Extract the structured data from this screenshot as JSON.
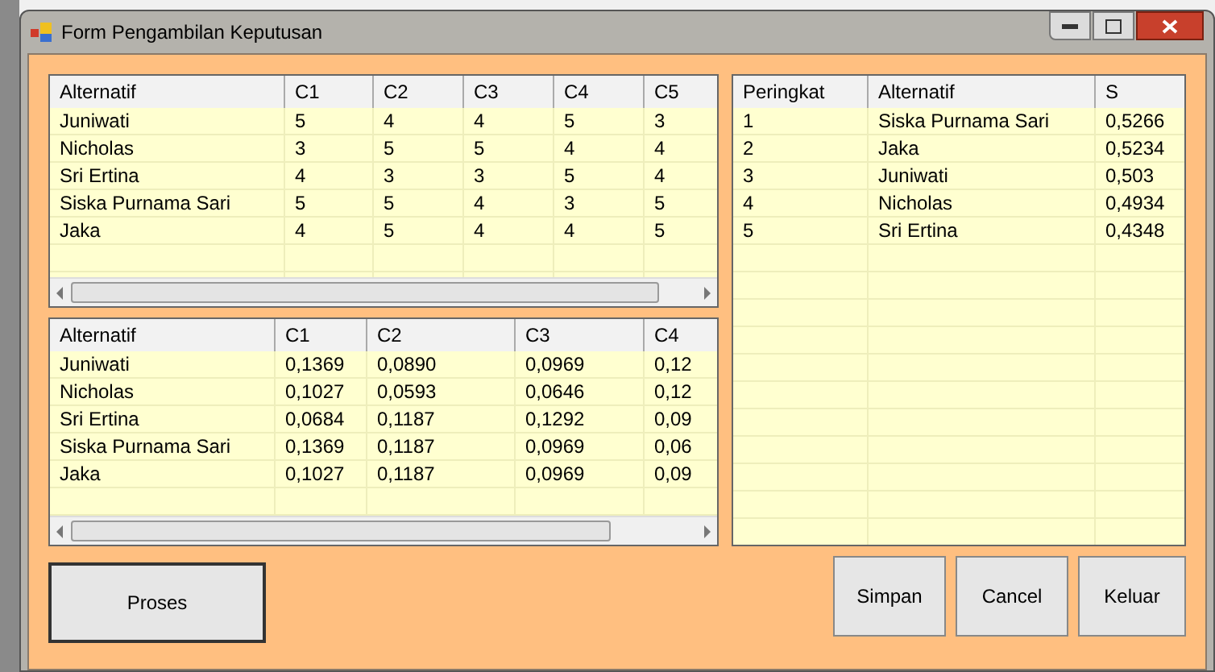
{
  "window": {
    "title": "Form Pengambilan Keputusan"
  },
  "criteria_table": {
    "columns": [
      "Alternatif",
      "C1",
      "C2",
      "C3",
      "C4",
      "C5"
    ],
    "rows": [
      [
        "Juniwati",
        "5",
        "4",
        "4",
        "5",
        "3"
      ],
      [
        "Nicholas",
        "3",
        "5",
        "5",
        "4",
        "4"
      ],
      [
        "Sri Ertina",
        "4",
        "3",
        "3",
        "5",
        "4"
      ],
      [
        "Siska Purnama Sari",
        "5",
        "5",
        "4",
        "3",
        "5"
      ],
      [
        "Jaka",
        "4",
        "5",
        "4",
        "4",
        "5"
      ]
    ]
  },
  "weighted_table": {
    "columns": [
      "Alternatif",
      "C1",
      "C2",
      "C3",
      "C4"
    ],
    "rows": [
      [
        "Juniwati",
        "0,1369",
        "0,0890",
        "0,0969",
        "0,12"
      ],
      [
        "Nicholas",
        "0,1027",
        "0,0593",
        "0,0646",
        "0,12"
      ],
      [
        "Sri Ertina",
        "0,0684",
        "0,1187",
        "0,1292",
        "0,09"
      ],
      [
        "Siska Purnama Sari",
        "0,1369",
        "0,1187",
        "0,0969",
        "0,06"
      ],
      [
        "Jaka",
        "0,1027",
        "0,1187",
        "0,0969",
        "0,09"
      ]
    ]
  },
  "ranking_table": {
    "columns": [
      "Peringkat",
      "Alternatif",
      "S"
    ],
    "rows": [
      [
        "1",
        "Siska Purnama Sari",
        "0,5266"
      ],
      [
        "2",
        "Jaka",
        "0,5234"
      ],
      [
        "3",
        "Juniwati",
        "0,503"
      ],
      [
        "4",
        "Nicholas",
        "0,4934"
      ],
      [
        "5",
        "Sri Ertina",
        "0,4348"
      ]
    ]
  },
  "buttons": [
    {
      "label": "Proses"
    },
    {
      "label": "Simpan"
    },
    {
      "label": "Cancel"
    },
    {
      "label": "Keluar"
    }
  ]
}
